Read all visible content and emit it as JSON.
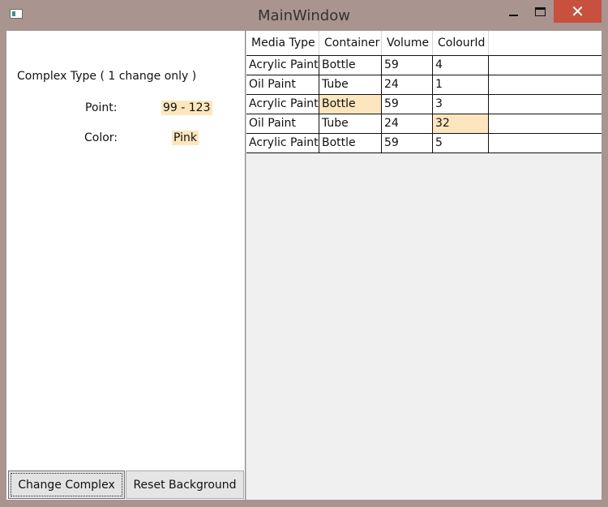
{
  "window": {
    "title": "MainWindow",
    "controls": [
      "minimize-icon",
      "maximize-icon",
      "close-icon"
    ],
    "close_glyph": "✕"
  },
  "left_panel": {
    "complex_title": "Complex Type ( 1 change only )",
    "point_label": "Point:",
    "point_value": "99 - 123",
    "color_label": "Color:",
    "color_value": "Pink",
    "change_complex_label": "Change Complex",
    "reset_background_label": "Reset Background"
  },
  "grid": {
    "columns": [
      "Media Type",
      "Container",
      "Volume",
      "ColourId"
    ],
    "rows": [
      [
        "Acrylic Paint",
        "Bottle",
        "59",
        "4"
      ],
      [
        "Oil Paint",
        "Tube",
        "24",
        "1"
      ],
      [
        "Acrylic Paint",
        "Bottle",
        "59",
        "3"
      ],
      [
        "Oil Paint",
        "Tube",
        "24",
        "32"
      ],
      [
        "Acrylic Paint",
        "Bottle",
        "59",
        "5"
      ]
    ],
    "highlighted_cells": [
      {
        "row": 2,
        "col": 1
      },
      {
        "row": 3,
        "col": 3
      }
    ]
  },
  "colors": {
    "window_frame": "#a99490",
    "close_button": "#c7503f",
    "highlight": "#fde6be",
    "grid_background": "#f0f0f0"
  }
}
